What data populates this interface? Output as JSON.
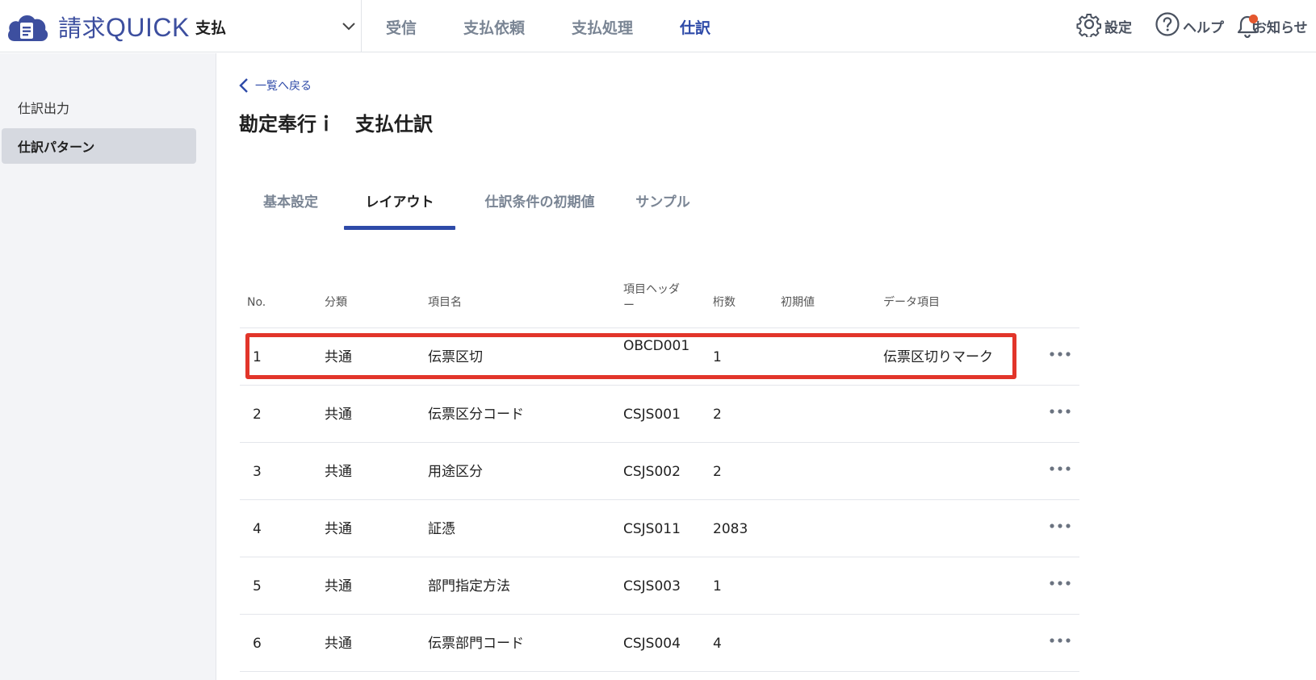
{
  "header": {
    "logo": {
      "kanji": "請求",
      "latin": "QUICK"
    },
    "company": "支払",
    "nav": [
      "受信",
      "支払依頼",
      "支払処理",
      "仕訳"
    ],
    "nav_active_index": 3,
    "settings_label": "設定",
    "help_label": "ヘルプ",
    "news_label": "お知らせ"
  },
  "sidebar": {
    "items": [
      {
        "label": "仕訳出力",
        "active": false
      },
      {
        "label": "仕訳パターン",
        "active": true
      }
    ]
  },
  "main": {
    "back_label": "一覧へ戻る",
    "title": "勘定奉行ｉ　支払仕訳",
    "tabs": [
      "基本設定",
      "レイアウト",
      "仕訳条件の初期値",
      "サンプル"
    ],
    "active_tab_index": 1
  },
  "table": {
    "headers": {
      "no": "No.",
      "category": "分類",
      "item_name": "項目名",
      "item_header": "項目ヘッダー",
      "digits": "桁数",
      "initial_value": "初期値",
      "data_item": "データ項目"
    },
    "rows": [
      {
        "no": "1",
        "category": "共通",
        "item_name": "伝票区切",
        "item_header": "OBCD001",
        "digits": "1",
        "initial_value": "",
        "data_item": "伝票区切りマーク",
        "highlighted": true
      },
      {
        "no": "2",
        "category": "共通",
        "item_name": "伝票区分コード",
        "item_header": "CSJS001",
        "digits": "2",
        "initial_value": "",
        "data_item": ""
      },
      {
        "no": "3",
        "category": "共通",
        "item_name": "用途区分",
        "item_header": "CSJS002",
        "digits": "2",
        "initial_value": "",
        "data_item": ""
      },
      {
        "no": "4",
        "category": "共通",
        "item_name": "証憑",
        "item_header": "CSJS011",
        "digits": "2083",
        "initial_value": "",
        "data_item": ""
      },
      {
        "no": "5",
        "category": "共通",
        "item_name": "部門指定方法",
        "item_header": "CSJS003",
        "digits": "1",
        "initial_value": "",
        "data_item": ""
      },
      {
        "no": "6",
        "category": "共通",
        "item_name": "伝票部門コード",
        "item_header": "CSJS004",
        "digits": "4",
        "initial_value": "",
        "data_item": ""
      }
    ]
  },
  "colors": {
    "brand": "#3d4f9f",
    "accent": "#2e4aa8",
    "highlight": "#e2352a",
    "notification_dot": "#e4572e"
  },
  "icons": {
    "logo": "cloud-document-icon",
    "company_toggle": "chevron-down-icon",
    "settings": "gear-icon",
    "help": "question-circle-icon",
    "news": "bell-icon",
    "back": "chevron-left-icon",
    "row_menu": "more-horizontal-icon"
  }
}
